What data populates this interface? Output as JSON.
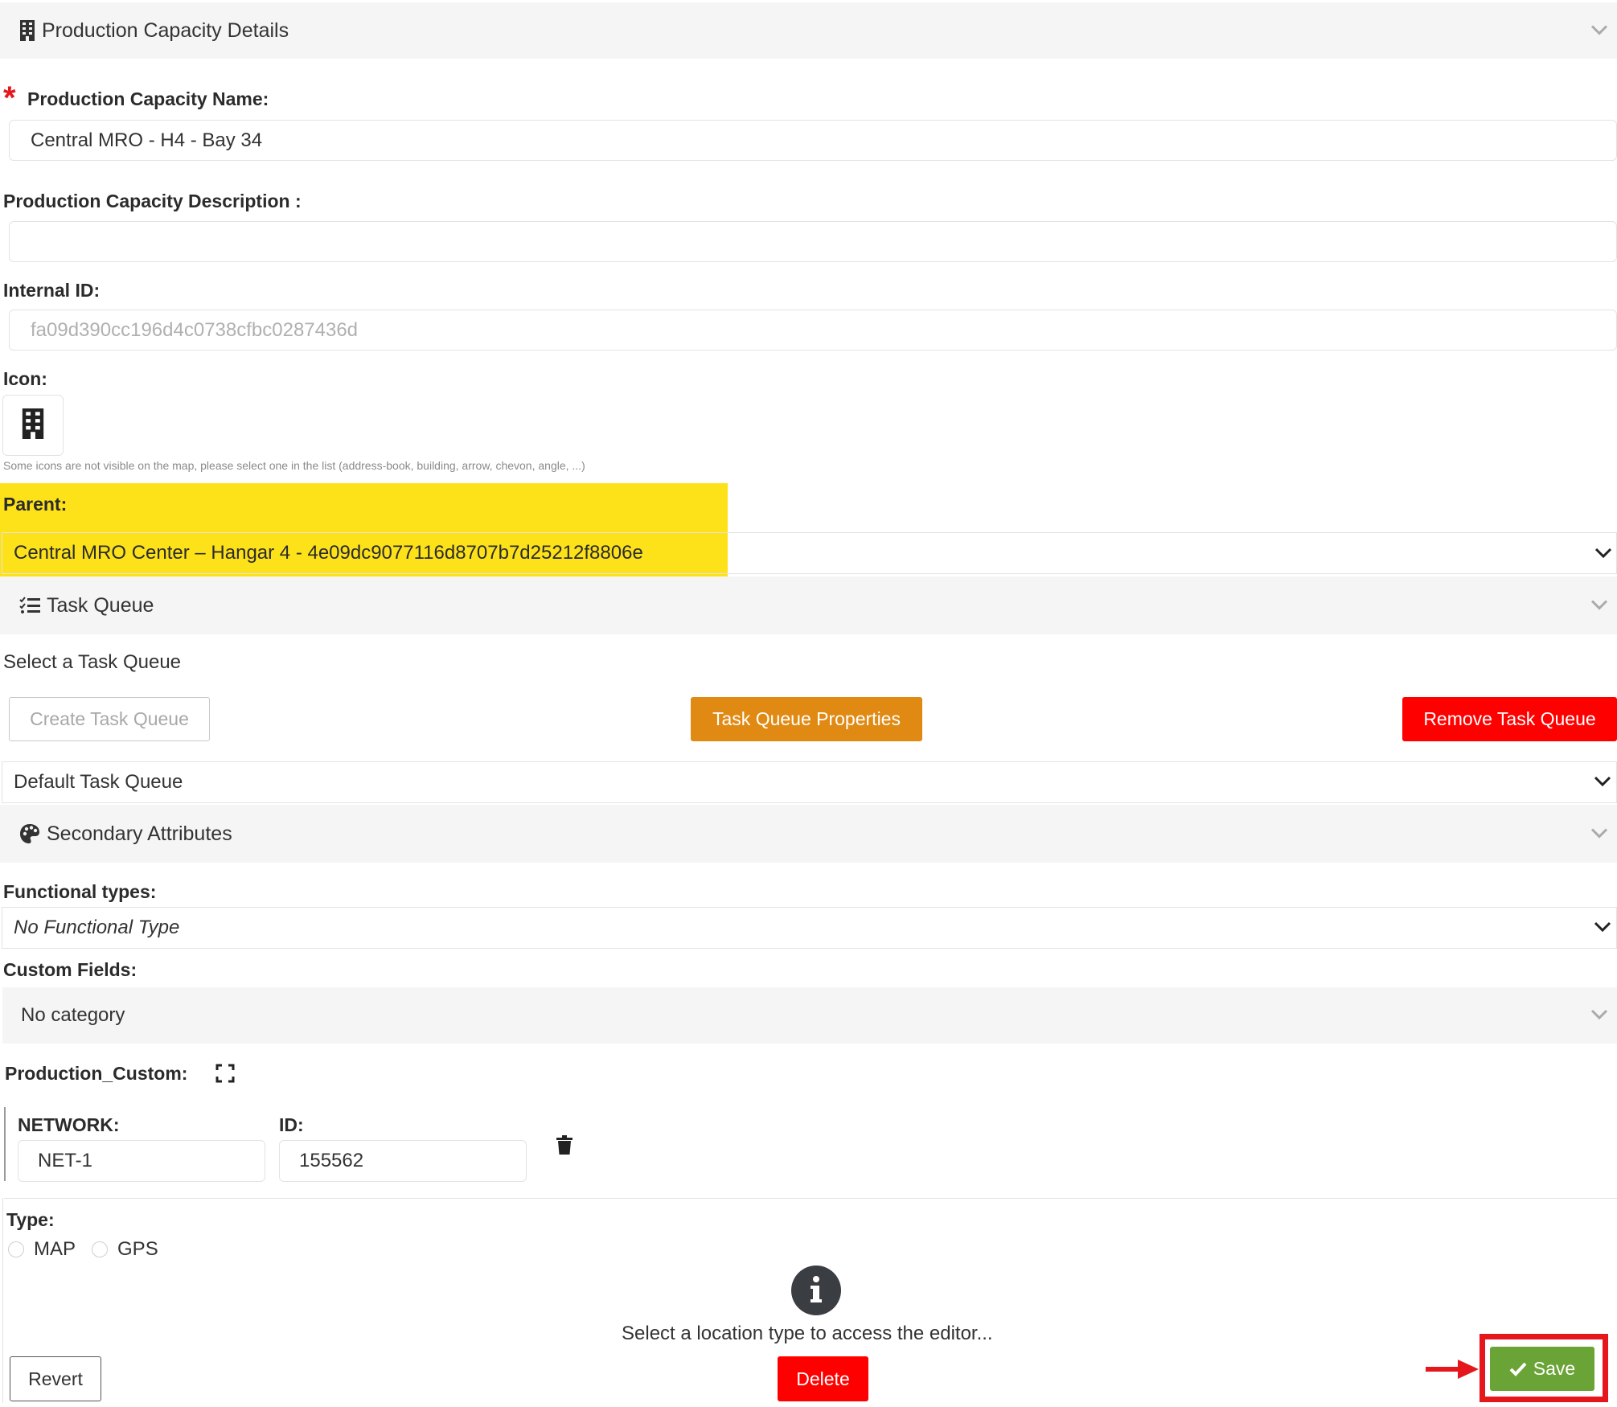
{
  "sections": {
    "details": "Production Capacity Details",
    "task_queue": "Task Queue",
    "secondary": "Secondary Attributes"
  },
  "fields": {
    "required_mark": "*",
    "name_label": "Production Capacity Name:",
    "name_value": "Central MRO - H4 - Bay 34",
    "description_label": "Production Capacity Description :",
    "description_value": "",
    "internal_id_label": "Internal ID:",
    "internal_id_value": "fa09d390cc196d4c0738cfbc0287436d",
    "icon_label": "Icon:",
    "icon_hint": "Some icons are not visible on the map, please select one in the list (address-book, building, arrow, chevon, angle, ...)",
    "parent_label": "Parent:",
    "parent_value": "Central MRO Center – Hangar 4 - 4e09dc9077116d8707b7d25212f8806e"
  },
  "task_queue": {
    "prompt": "Select a Task Queue",
    "create_button": "Create Task Queue",
    "properties_button": "Task Queue Properties",
    "remove_button": "Remove Task Queue",
    "selected": "Default Task Queue"
  },
  "secondary": {
    "functional_types_label": "Functional types:",
    "functional_types_value": "No Functional Type",
    "custom_fields_label": "Custom Fields:",
    "category": "No category",
    "group_label": "Production_Custom:",
    "network_label": "NETWORK:",
    "network_value": "NET-1",
    "id_label": "ID:",
    "id_value": "155562"
  },
  "location": {
    "type_label": "Type:",
    "options": [
      "MAP",
      "GPS"
    ],
    "message": "Select a location type to access the editor..."
  },
  "actions": {
    "revert": "Revert",
    "delete": "Delete",
    "save": "Save"
  },
  "colors": {
    "highlight": "#fde21a",
    "orange": "#e08a14",
    "red": "#ff0000",
    "green": "#6aa336",
    "annotation": "#e5161c"
  }
}
